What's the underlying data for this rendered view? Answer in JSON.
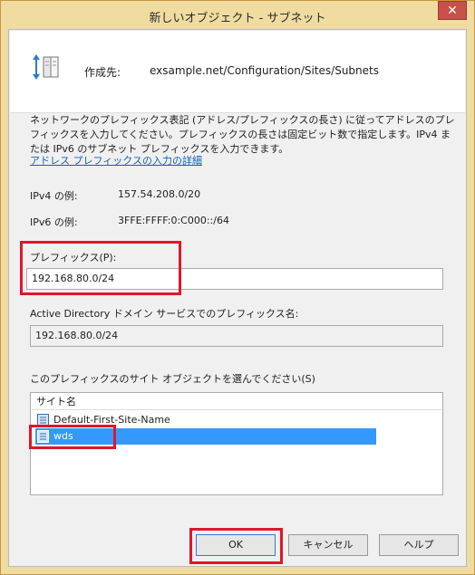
{
  "window": {
    "title": "新しいオブジェクト - サブネット",
    "close_glyph": "✕"
  },
  "header": {
    "create_label": "作成先:",
    "create_path": "exsample.net/Configuration/Sites/Subnets"
  },
  "description": {
    "lines": [
      "ネットワークのプレフィックス表記 (アドレス/プレフィックスの長さ) に従ってアドレスのプレ",
      "フィックスを入力してください。プレフィックスの長さは固定ビット数で指定します。IPv4 ま",
      "たは IPv6 のサブネット プレフィックスを入力できます。"
    ],
    "link": "アドレス プレフィックスの入力の詳細"
  },
  "examples": {
    "ipv4_label": "IPv4 の例:",
    "ipv4_value": "157.54.208.0/20",
    "ipv6_label": "IPv6 の例:",
    "ipv6_value": "3FFE:FFFF:0:C000::/64"
  },
  "prefix": {
    "label": "プレフィックス(P):",
    "value": "192.168.80.0/24"
  },
  "ad_prefix": {
    "label": "Active Directory ドメイン サービスでのプレフィックス名:",
    "value": "192.168.80.0/24"
  },
  "sites": {
    "label": "このプレフィックスのサイト オブジェクトを選んでください(S)",
    "column": "サイト名",
    "items": [
      {
        "name": "Default-First-Site-Name",
        "selected": false
      },
      {
        "name": "wds",
        "selected": true
      }
    ]
  },
  "buttons": {
    "ok": "OK",
    "cancel": "キャンセル",
    "help": "ヘルプ"
  },
  "colors": {
    "highlight": "#e0162b",
    "selection": "#3399ff",
    "frame": "#f0dca0",
    "close": "#c7504b"
  }
}
